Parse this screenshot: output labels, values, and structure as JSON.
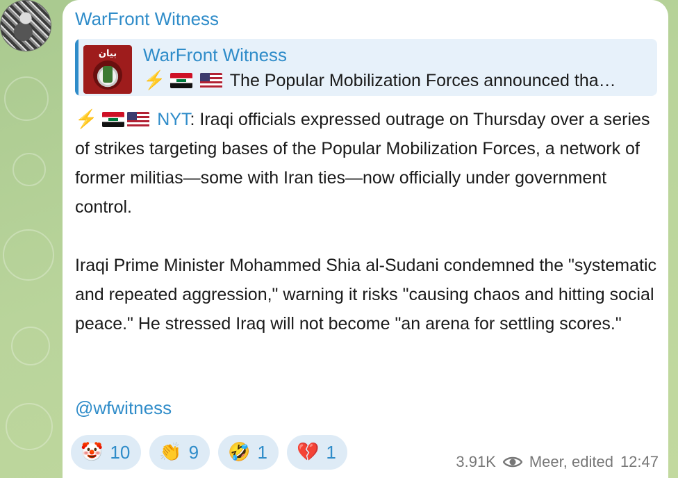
{
  "channel": {
    "author": "WarFront Witness",
    "avatar_icon": "soldier-avatar",
    "thumb_text": "بيان"
  },
  "quote": {
    "title": "WarFront Witness",
    "text": "The Popular Mobilization Forces announced tha…"
  },
  "body": {
    "source_link": "NYT",
    "para1_rest": ": Iraqi officials expressed outrage on Thursday over a series of strikes targeting bases of the Popular Mobilization Forces, a network of former militias—some with Iran ties—now officially under government control.",
    "para2": "Iraqi Prime Minister Mohammed Shia al-Sudani condemned the \"systematic and repeated aggression,\" warning it risks \"causing chaos and hitting social peace.\" He stressed Iraq will not become \"an arena for settling scores.\""
  },
  "handle": "@wfwitness",
  "reactions": [
    {
      "icon": "clown-face-icon",
      "glyph": "🤡",
      "count": "10"
    },
    {
      "icon": "clapping-hands-icon",
      "glyph": "👏",
      "count": "9"
    },
    {
      "icon": "rofl-icon",
      "glyph": "🤣",
      "count": "1"
    },
    {
      "icon": "broken-heart-icon",
      "glyph": "💔",
      "count": "1"
    }
  ],
  "meta": {
    "views": "3.91K",
    "edited": "Meer, edited",
    "time": "12:47"
  },
  "colors": {
    "accent": "#2f8cc9",
    "quote_bg": "#e7f1fa",
    "reaction_bg": "#deebf6"
  }
}
